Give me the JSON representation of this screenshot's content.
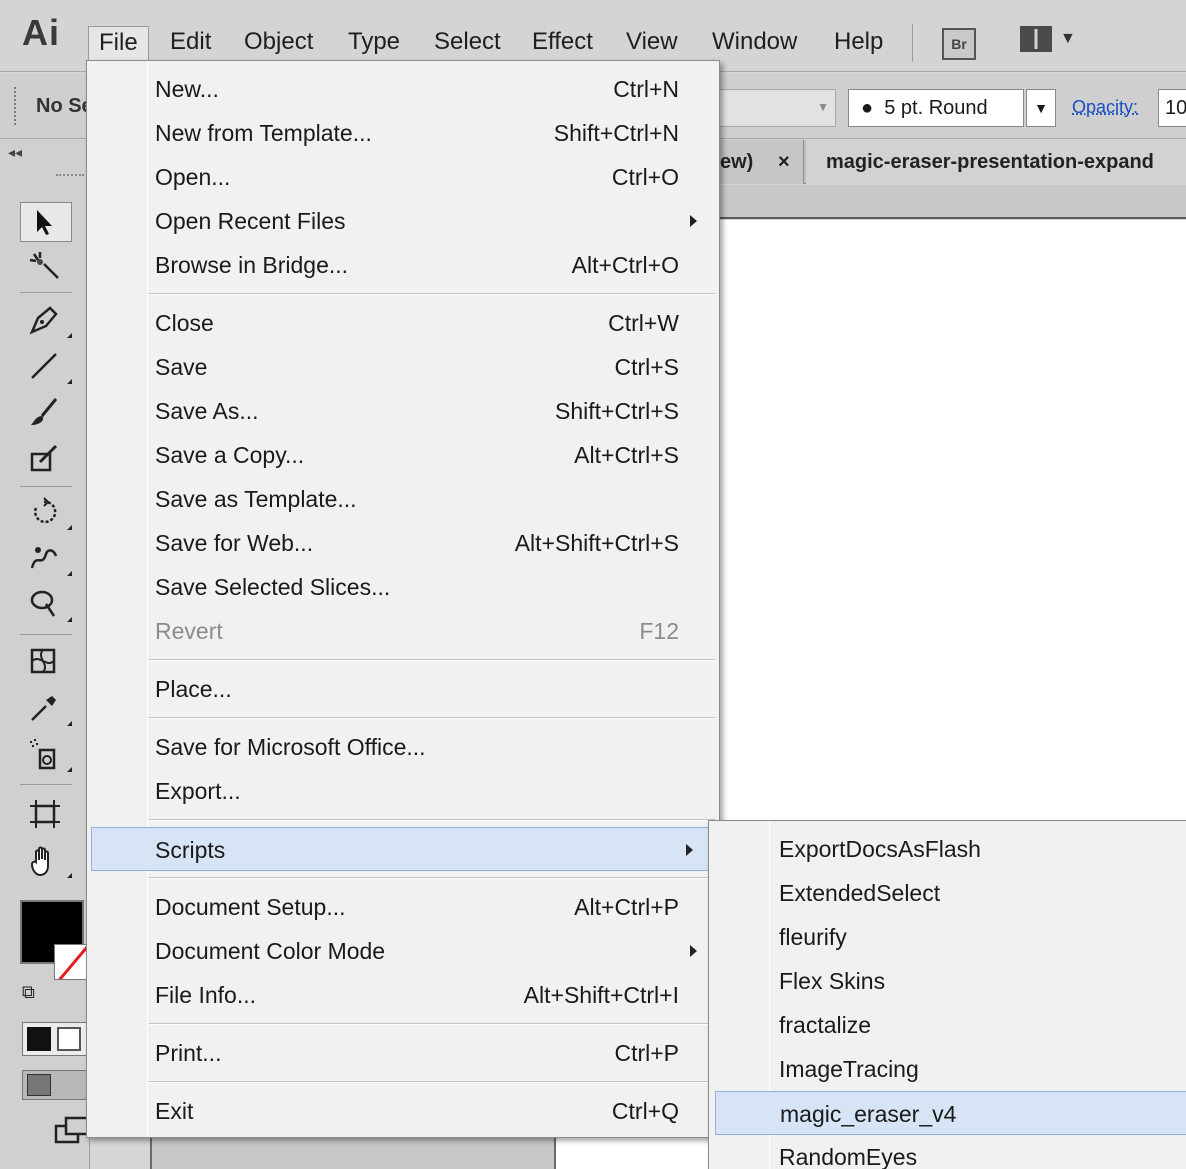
{
  "app": {
    "logo": "Ai"
  },
  "menubar": {
    "items": [
      "File",
      "Edit",
      "Object",
      "Type",
      "Select",
      "Effect",
      "View",
      "Window",
      "Help"
    ],
    "bridge_badge": "Br"
  },
  "controlbar": {
    "selection_label": "No Se",
    "brush_value": "5 pt. Round",
    "opacity_label": "Opacity:",
    "opacity_value": "10"
  },
  "tabs": {
    "tab1": "ew)",
    "tab1_close": "×",
    "tab2": "magic-eraser-presentation-expand"
  },
  "file_menu": {
    "items": [
      {
        "label": "New...",
        "shortcut": "Ctrl+N"
      },
      {
        "label": "New from Template...",
        "shortcut": "Shift+Ctrl+N"
      },
      {
        "label": "Open...",
        "shortcut": "Ctrl+O"
      },
      {
        "label": "Open Recent Files",
        "shortcut": ""
      },
      {
        "label": "Browse in Bridge...",
        "shortcut": "Alt+Ctrl+O"
      },
      {
        "label": "Close",
        "shortcut": "Ctrl+W"
      },
      {
        "label": "Save",
        "shortcut": "Ctrl+S"
      },
      {
        "label": "Save As...",
        "shortcut": "Shift+Ctrl+S"
      },
      {
        "label": "Save a Copy...",
        "shortcut": "Alt+Ctrl+S"
      },
      {
        "label": "Save as Template...",
        "shortcut": ""
      },
      {
        "label": "Save for Web...",
        "shortcut": "Alt+Shift+Ctrl+S"
      },
      {
        "label": "Save Selected Slices...",
        "shortcut": ""
      },
      {
        "label": "Revert",
        "shortcut": "F12"
      },
      {
        "label": "Place...",
        "shortcut": ""
      },
      {
        "label": "Save for Microsoft Office...",
        "shortcut": ""
      },
      {
        "label": "Export...",
        "shortcut": ""
      },
      {
        "label": "Scripts",
        "shortcut": ""
      },
      {
        "label": "Document Setup...",
        "shortcut": "Alt+Ctrl+P"
      },
      {
        "label": "Document Color Mode",
        "shortcut": ""
      },
      {
        "label": "File Info...",
        "shortcut": "Alt+Shift+Ctrl+I"
      },
      {
        "label": "Print...",
        "shortcut": "Ctrl+P"
      },
      {
        "label": "Exit",
        "shortcut": "Ctrl+Q"
      }
    ]
  },
  "scripts_menu": {
    "items": [
      "ExportDocsAsFlash",
      "ExtendedSelect",
      "fleurify",
      "Flex Skins",
      "fractalize",
      "ImageTracing",
      "magic_eraser_v4",
      "RandomEyes"
    ]
  },
  "colors": {
    "highlight": "#d6e4f5",
    "highlight_border": "#8fb3dd",
    "menu_bg": "#f1f1f1",
    "link": "#1a4fc4",
    "stroke_none_slash": "#e02020"
  },
  "icons": {
    "tools": [
      "selection-arrow-icon",
      "magic-wand-icon",
      "pen-icon",
      "line-segment-icon",
      "paintbrush-icon",
      "blob-brush-icon",
      "rotate-icon",
      "warp-icon",
      "shape-builder-icon",
      "mesh-icon",
      "eyedropper-icon",
      "symbol-sprayer-icon",
      "artboard-icon",
      "hand-icon"
    ]
  }
}
